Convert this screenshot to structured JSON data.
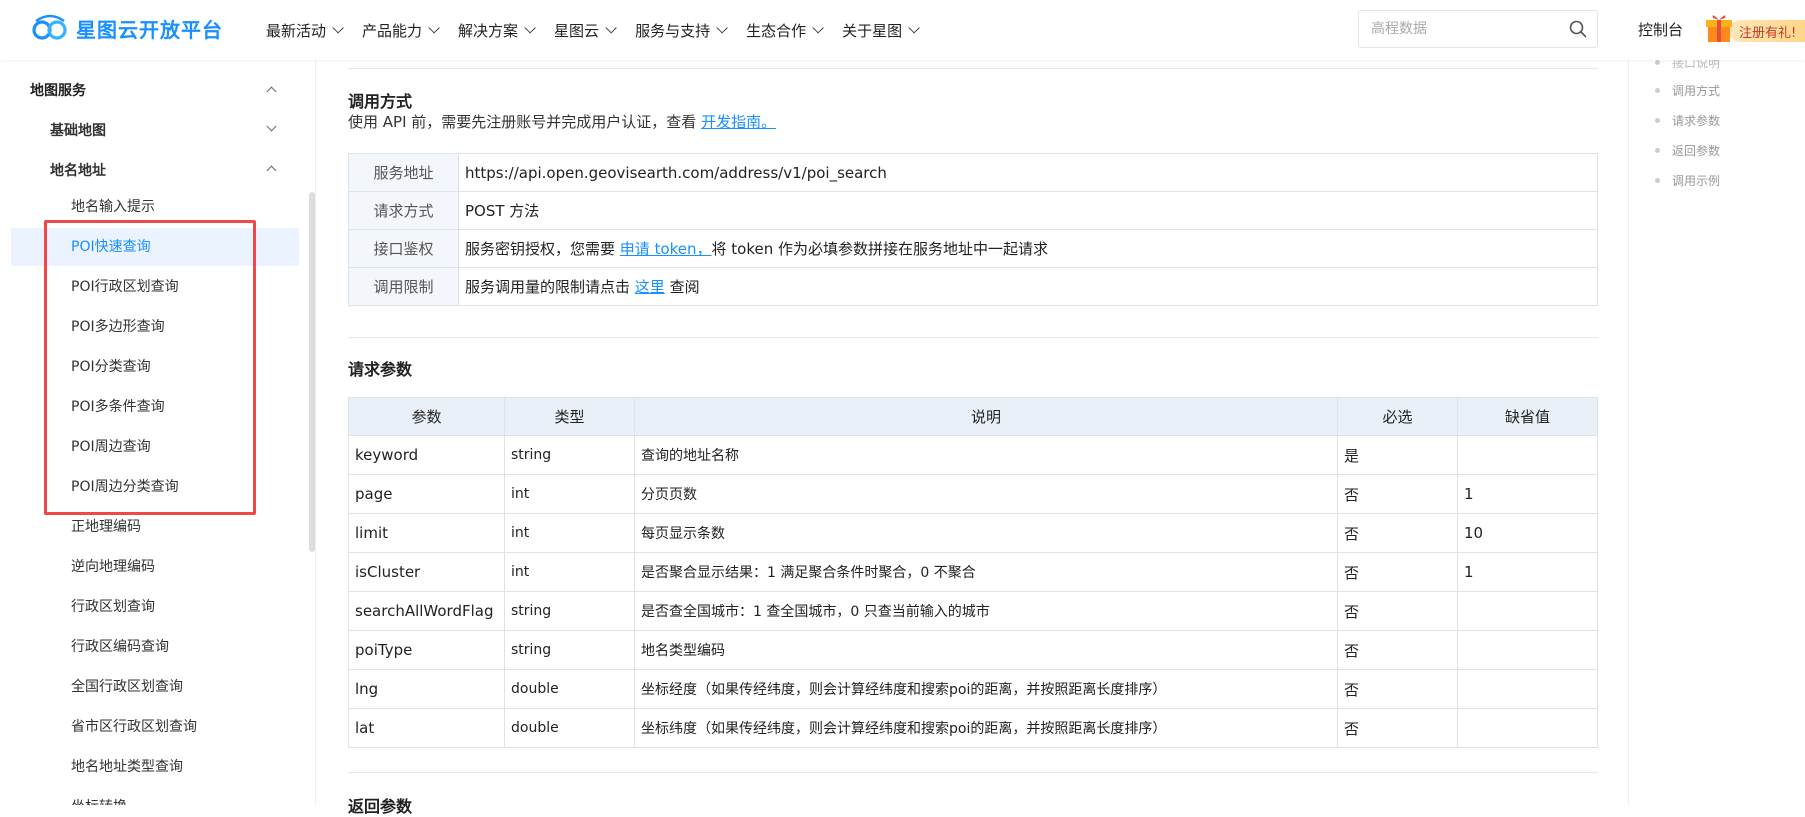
{
  "header": {
    "logo_text": "星图云开放平台",
    "nav": [
      "最新活动",
      "产品能力",
      "解决方案",
      "星图云",
      "服务与支持",
      "生态合作",
      "关于星图"
    ],
    "search_placeholder": "高程数据",
    "console_label": "控制台",
    "gift_label": "注册有礼!"
  },
  "sidebar": {
    "group_label": "地图服务",
    "basic_map_label": "基础地图",
    "place_label": "地名地址",
    "items": [
      "地名输入提示",
      "POI快速查询",
      "POI行政区划查询",
      "POI多边形查询",
      "POI分类查询",
      "POI多条件查询",
      "POI周边查询",
      "POI周边分类查询",
      "正地理编码",
      "逆向地理编码",
      "行政区划查询",
      "行政区编码查询",
      "全国行政区划查询",
      "省市区行政区划查询",
      "地名地址类型查询",
      "坐标转换"
    ],
    "active_index": 1
  },
  "main": {
    "call_title": "调用方式",
    "call_desc_prefix": "使用 API 前，需要先注册账号并完成用户认证，查看",
    "call_desc_link": "开发指南。",
    "info_rows": {
      "service_url_key": "服务地址",
      "service_url_val": "https://api.open.geovisearth.com/address/v1/poi_search",
      "method_key": "请求方式",
      "method_val": "POST 方法",
      "auth_key": "接口鉴权",
      "auth_prefix": "服务密钥授权，您需要",
      "auth_link": "申请 token，",
      "auth_suffix": "将 token 作为必填参数拼接在服务地址中一起请求",
      "limit_key": "调用限制",
      "limit_prefix": "服务调用量的限制请点击",
      "limit_link": "这里",
      "limit_suffix": "查阅"
    },
    "params_title": "请求参数",
    "params_headers": [
      "参数",
      "类型",
      "说明",
      "必选",
      "缺省值"
    ],
    "params_rows": [
      [
        "keyword",
        "string",
        "查询的地址名称",
        "是",
        ""
      ],
      [
        "page",
        "int",
        "分页页数",
        "否",
        "1"
      ],
      [
        "limit",
        "int",
        "每页显示条数",
        "否",
        "10"
      ],
      [
        "isCluster",
        "int",
        "是否聚合显示结果：1 满足聚合条件时聚合，0 不聚合",
        "否",
        "1"
      ],
      [
        "searchAllWordFlag",
        "string",
        "是否查全国城市：1 查全国城市，0 只查当前输入的城市",
        "否",
        ""
      ],
      [
        "poiType",
        "string",
        "地名类型编码",
        "否",
        ""
      ],
      [
        "lng",
        "double",
        "坐标经度（如果传经纬度，则会计算经纬度和搜索poi的距离，并按照距离长度排序）",
        "否",
        ""
      ],
      [
        "lat",
        "double",
        "坐标纬度（如果传经纬度，则会计算经纬度和搜索poi的距离，并按照距离长度排序）",
        "否",
        ""
      ]
    ],
    "return_title": "返回参数"
  },
  "toc": {
    "items": [
      "接口说明",
      "调用方式",
      "请求参数",
      "返回参数",
      "调用示例"
    ]
  },
  "colors": {
    "accent": "#1890ff",
    "highlight_box": "#f04848",
    "active_bg": "#eaf3ff"
  }
}
